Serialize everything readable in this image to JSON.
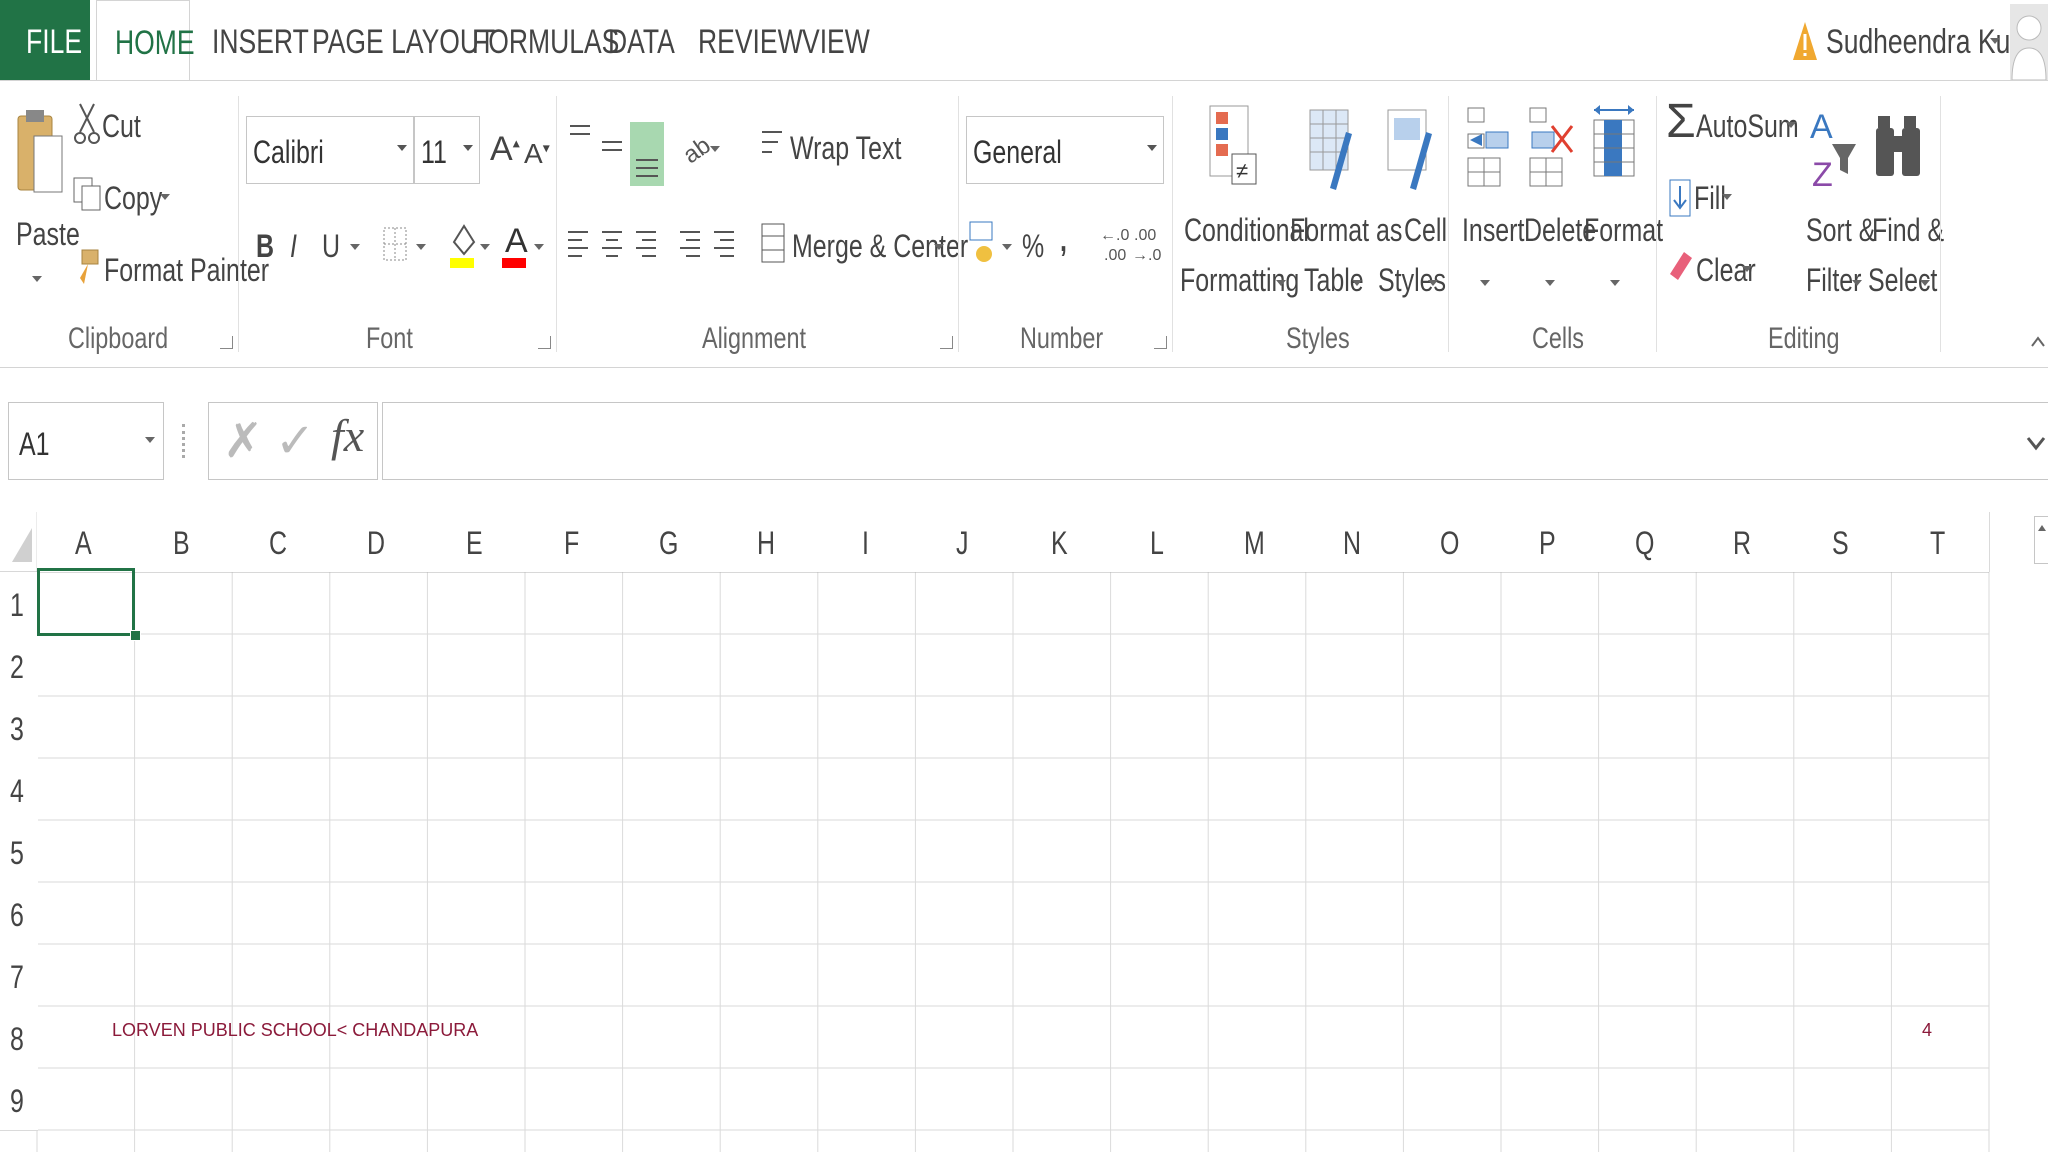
{
  "tabs": {
    "file": "FILE",
    "home": "HOME",
    "insert": "INSERT",
    "page_layout": "PAGE LAYOUT",
    "formulas": "FORMULAS",
    "data": "DATA",
    "review": "REVIEW",
    "view": "VIEW"
  },
  "user": {
    "name": "Sudheendra Kumar"
  },
  "clipboard": {
    "paste": "Paste",
    "cut": "Cut",
    "copy": "Copy",
    "format_painter": "Format Painter",
    "group": "Clipboard"
  },
  "font": {
    "family": "Calibri",
    "size": "11",
    "bold": "B",
    "italic": "I",
    "underline": "U",
    "group": "Font",
    "highlight_color": "#ffff00",
    "font_color": "#ff0000"
  },
  "alignment": {
    "wrap_text": "Wrap Text",
    "merge_center": "Merge & Center",
    "group": "Alignment"
  },
  "number": {
    "format": "General",
    "percent": "%",
    "comma": ",",
    "group": "Number"
  },
  "styles": {
    "conditional_1": "Conditional",
    "conditional_2": "Formatting",
    "format_table_1": "Format as",
    "format_table_2": "Table",
    "cell_styles_1": "Cell",
    "cell_styles_2": "Styles",
    "group": "Styles"
  },
  "cells": {
    "insert": "Insert",
    "delete": "Delete",
    "format": "Format",
    "group": "Cells"
  },
  "editing": {
    "autosum": "AutoSum",
    "fill": "Fill",
    "clear": "Clear",
    "sort_1": "Sort &",
    "sort_2": "Filter",
    "find_1": "Find &",
    "find_2": "Select",
    "group": "Editing"
  },
  "formula_bar": {
    "name_box": "A1",
    "cancel": "✗",
    "enter": "✓",
    "fx": "fx",
    "value": ""
  },
  "grid": {
    "columns": [
      "A",
      "B",
      "C",
      "D",
      "E",
      "F",
      "G",
      "H",
      "I",
      "J",
      "K",
      "L",
      "M",
      "N",
      "O",
      "P",
      "Q",
      "R",
      "S",
      "T"
    ],
    "rows": [
      "1",
      "2",
      "3",
      "4",
      "5",
      "6",
      "7",
      "8",
      "9"
    ],
    "selected_cell": "A1",
    "cells": {
      "A8": "LORVEN PUBLIC SCHOOL< CHANDAPURA",
      "T8": "4"
    }
  },
  "colors": {
    "accent": "#217346",
    "top_bar": "#c00000",
    "cell_text": "#8b1a3a"
  }
}
